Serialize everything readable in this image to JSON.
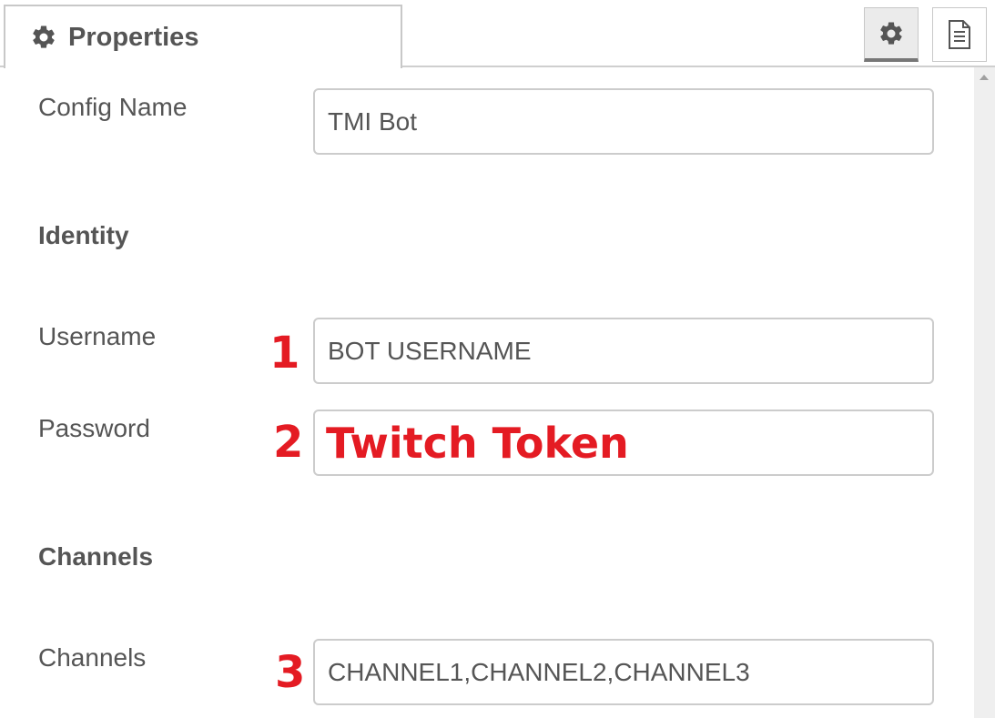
{
  "tab": {
    "label": "Properties",
    "icon": "gear-icon"
  },
  "toolbar": {
    "settings_icon": "gear-icon",
    "doc_icon": "document-icon"
  },
  "form": {
    "config_name_label": "Config Name",
    "config_name_value": "TMI Bot",
    "identity_heading": "Identity",
    "username_label": "Username",
    "username_value": "BOT USERNAME",
    "password_label": "Password",
    "password_value": "Twitch Token",
    "channels_heading": "Channels",
    "channels_label": "Channels",
    "channels_value": "CHANNEL1,CHANNEL2,CHANNEL3"
  },
  "annotations": {
    "marker_1": "1",
    "marker_2": "2",
    "marker_3": "3"
  },
  "colors": {
    "annotation_red": "#e41b23",
    "text_gray": "#555555"
  }
}
